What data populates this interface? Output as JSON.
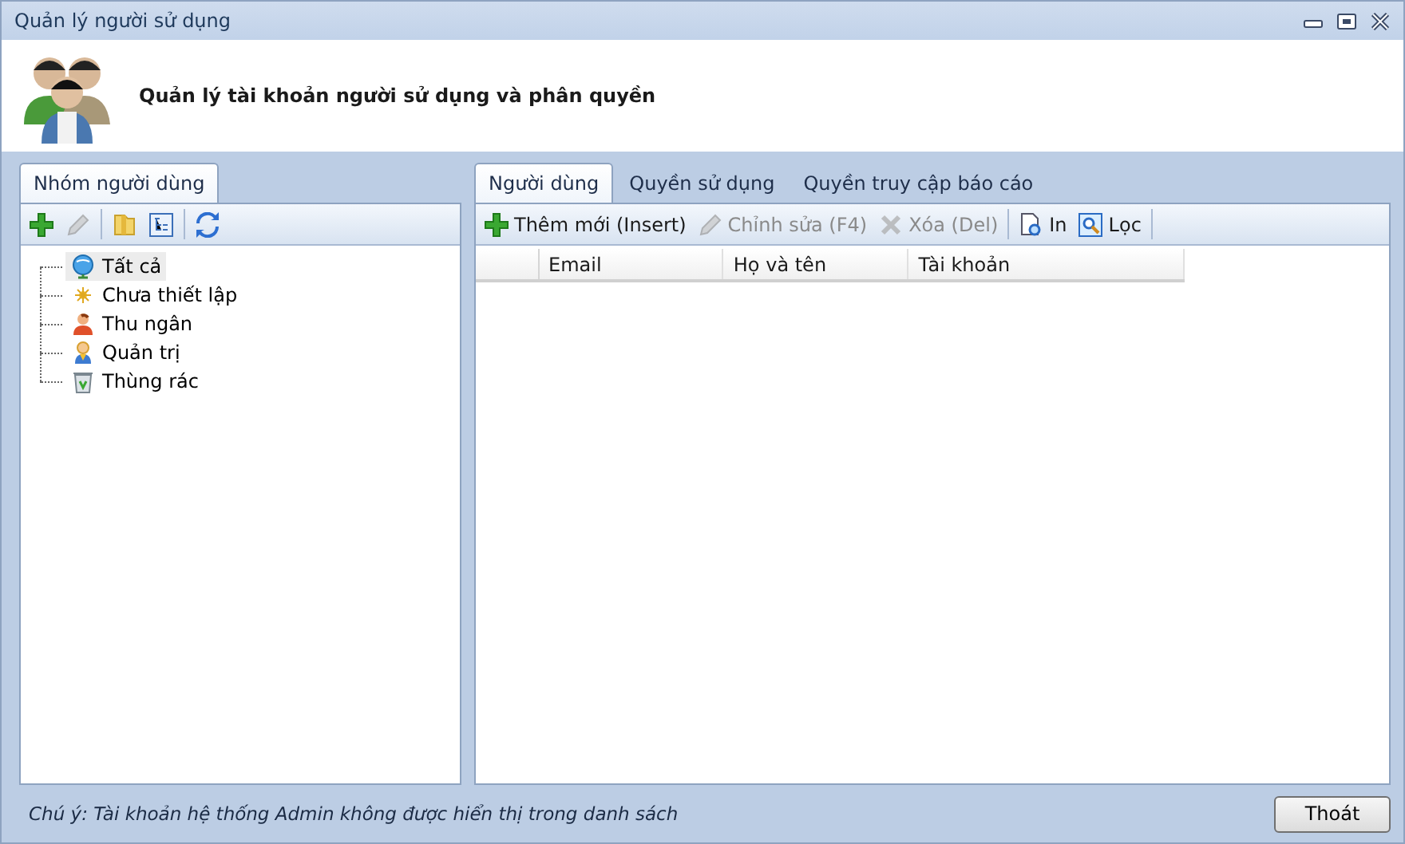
{
  "window": {
    "title": "Quản lý người sử dụng"
  },
  "header": {
    "title": "Quản lý tài khoản người sử dụng và phân quyền"
  },
  "left_panel": {
    "tabs": [
      {
        "label": "Nhóm người dùng",
        "selected": true
      }
    ],
    "toolbar": [
      {
        "kind": "add",
        "disabled": false
      },
      {
        "kind": "edit",
        "disabled": true
      },
      {
        "kind": "folder",
        "disabled": false
      },
      {
        "kind": "tree",
        "disabled": false
      },
      {
        "kind": "refresh",
        "disabled": false
      }
    ],
    "tree": [
      {
        "label": "Tất cả",
        "kind": "globe",
        "selected": true
      },
      {
        "label": "Chưa thiết lập",
        "kind": "star",
        "selected": false
      },
      {
        "label": "Thu ngân",
        "kind": "person",
        "selected": false
      },
      {
        "label": "Quản trị",
        "kind": "admin",
        "selected": false
      },
      {
        "label": "Thùng rác",
        "kind": "trash",
        "selected": false
      }
    ]
  },
  "right_panel": {
    "tabs": [
      {
        "label": "Người dùng",
        "selected": true
      },
      {
        "label": "Quyền sử dụng",
        "selected": false
      },
      {
        "label": "Quyền truy cập báo cáo",
        "selected": false
      }
    ],
    "toolbar": [
      {
        "kind": "add",
        "label": "Thêm mới (Insert)",
        "disabled": false
      },
      {
        "kind": "edit",
        "label": "Chỉnh sửa (F4)",
        "disabled": true
      },
      {
        "kind": "delete",
        "label": "Xóa (Del)",
        "disabled": true
      },
      {
        "kind": "print",
        "label": "In",
        "disabled": false
      },
      {
        "kind": "filter",
        "label": "Lọc",
        "disabled": false
      }
    ],
    "table": {
      "columns": [
        "Email",
        "Họ và tên",
        "Tài khoản"
      ]
    }
  },
  "footer": {
    "note": "Chú ý: Tài khoản hệ thống Admin không được hiển thị trong danh sách",
    "buttons": [
      "Thoát"
    ]
  }
}
